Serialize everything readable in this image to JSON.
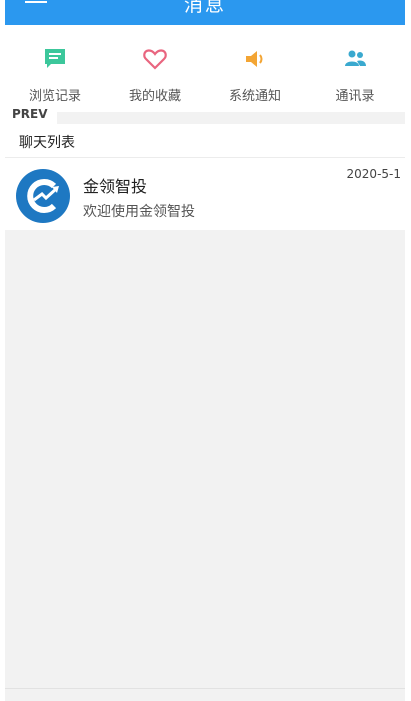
{
  "header": {
    "title": "消息"
  },
  "quick_tabs": [
    {
      "label": "浏览记录",
      "icon": "chat-bubble-icon",
      "color": "#3cc79b"
    },
    {
      "label": "我的收藏",
      "icon": "heart-icon",
      "color": "#e9657f"
    },
    {
      "label": "系统通知",
      "icon": "speaker-icon",
      "color": "#f3a534"
    },
    {
      "label": "通讯录",
      "icon": "contacts-icon",
      "color": "#3aa9cf"
    }
  ],
  "prev_label": "PREV",
  "chat_list": {
    "title": "聊天列表",
    "items": [
      {
        "name": "金领智投",
        "message": "欢迎使用金领智投",
        "date": "2020-5-1",
        "avatar_icon": "jinling-logo-icon",
        "avatar_color": "#1e78c2"
      }
    ]
  },
  "colors": {
    "header": "#2b98ef",
    "background": "#f2f2f2"
  }
}
